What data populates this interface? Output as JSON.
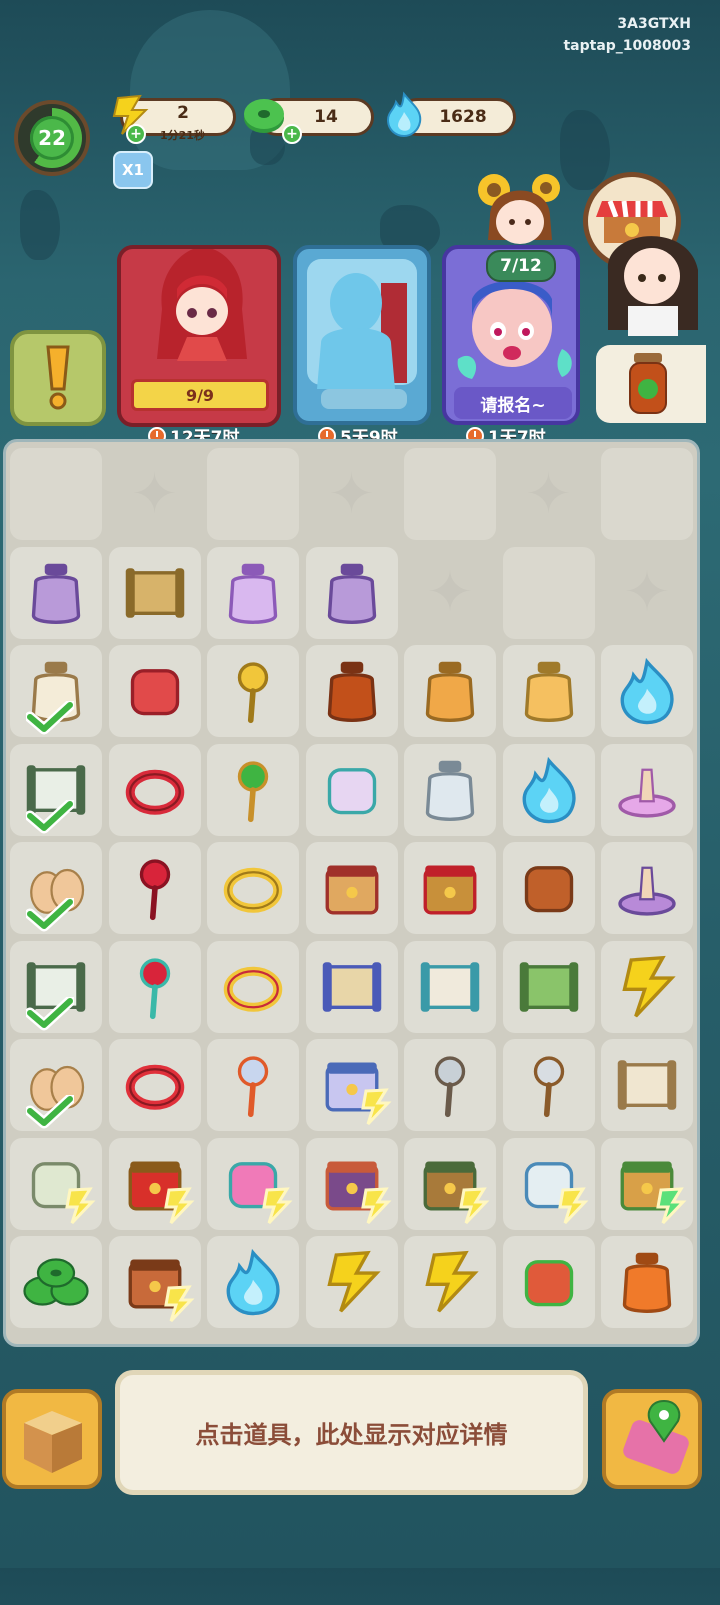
{
  "watermark": {
    "line1": "3A3GTXH",
    "line2": "taptap_1008003"
  },
  "player": {
    "level": "22"
  },
  "resources": {
    "energy": {
      "value": "2",
      "regen_timer": "1分21秒",
      "icon": "energy-bolt-icon"
    },
    "coins": {
      "value": "14",
      "icon": "jade-coin-icon"
    },
    "gems": {
      "value": "1628",
      "icon": "blue-flame-icon"
    }
  },
  "multiplier": {
    "label": "X1"
  },
  "orders": [
    {
      "id": "bride",
      "progress": "9/9",
      "timer": "12天7时"
    },
    {
      "id": "statue",
      "timer": "5天9时"
    },
    {
      "id": "guest",
      "progress": "7/12",
      "button": "请报名~",
      "timer": "1天7时"
    }
  ],
  "info_panel": {
    "text": "点击道具，此处显示对应详情"
  },
  "colors": {
    "background": "#2b6570",
    "board": "#cfcdc2",
    "cell": "#deddd4",
    "accent_gold": "#f1b843",
    "check_green": "#3fb442",
    "bolt_yellow": "#f5d21c"
  },
  "board": {
    "rows": [
      [
        "empty",
        "locked",
        "empty",
        "locked",
        "empty",
        "locked",
        "empty"
      ],
      [
        "purple-pouch-icon",
        "scroll-bundle-icon",
        "perfume-bottle-icon",
        "purple-jar-icon",
        "locked",
        "empty",
        "locked"
      ],
      [
        "seed-bag-icon",
        "red-envelope-icon",
        "butterfly-hairpin-icon",
        "soy-bottle-icon",
        "honey-jar-icon",
        "orange-jar-icon",
        "blue-flame-icon"
      ],
      [
        "sword-scroll-icon",
        "red-bracelet-icon",
        "jade-earrings-icon",
        "sachet-icon",
        "glass-bottle-icon",
        "blue-flame-icon",
        "pink-stand-icon"
      ],
      [
        "eggs-icon",
        "chinese-knot-icon",
        "gold-bangle-icon",
        "gift-box-icon",
        "picnic-basket-icon",
        "wood-plate-icon",
        "purple-cone-icon"
      ],
      [
        "sword-scroll-icon",
        "red-knot-tassel-icon",
        "gold-necklace-icon",
        "landscape-scroll-icon",
        "painting-scroll-icon",
        "flower-scroll-icon",
        "energy-bolt-icon"
      ],
      [
        "eggs-icon",
        "red-bangle-icon",
        "pipa-pendant-icon",
        "pearl-basket-icon",
        "brush-icon",
        "spoon-icon",
        "calligraphy-scroll-icon"
      ],
      [
        "cash-stack-icon",
        "red-screen-icon",
        "flower-pot-icon",
        "treasure-cabinet-icon",
        "green-cabinet-icon",
        "tea-set-icon",
        "dog-house-icon"
      ],
      [
        "jade-coins-icon",
        "treasure-chest-icon",
        "blue-flame-icon",
        "energy-bolt-icon",
        "energy-bolt-icon",
        "jewel-pile-icon",
        "orange-pouch-icon"
      ]
    ],
    "checks": [
      [
        2,
        0
      ],
      [
        3,
        0
      ],
      [
        4,
        0
      ],
      [
        5,
        0
      ],
      [
        6,
        0
      ]
    ],
    "generators": [
      [
        6,
        3
      ],
      [
        7,
        0
      ],
      [
        7,
        1
      ],
      [
        7,
        2
      ],
      [
        7,
        3
      ],
      [
        7,
        4
      ],
      [
        7,
        5
      ],
      [
        7,
        6
      ],
      [
        8,
        1
      ]
    ]
  }
}
